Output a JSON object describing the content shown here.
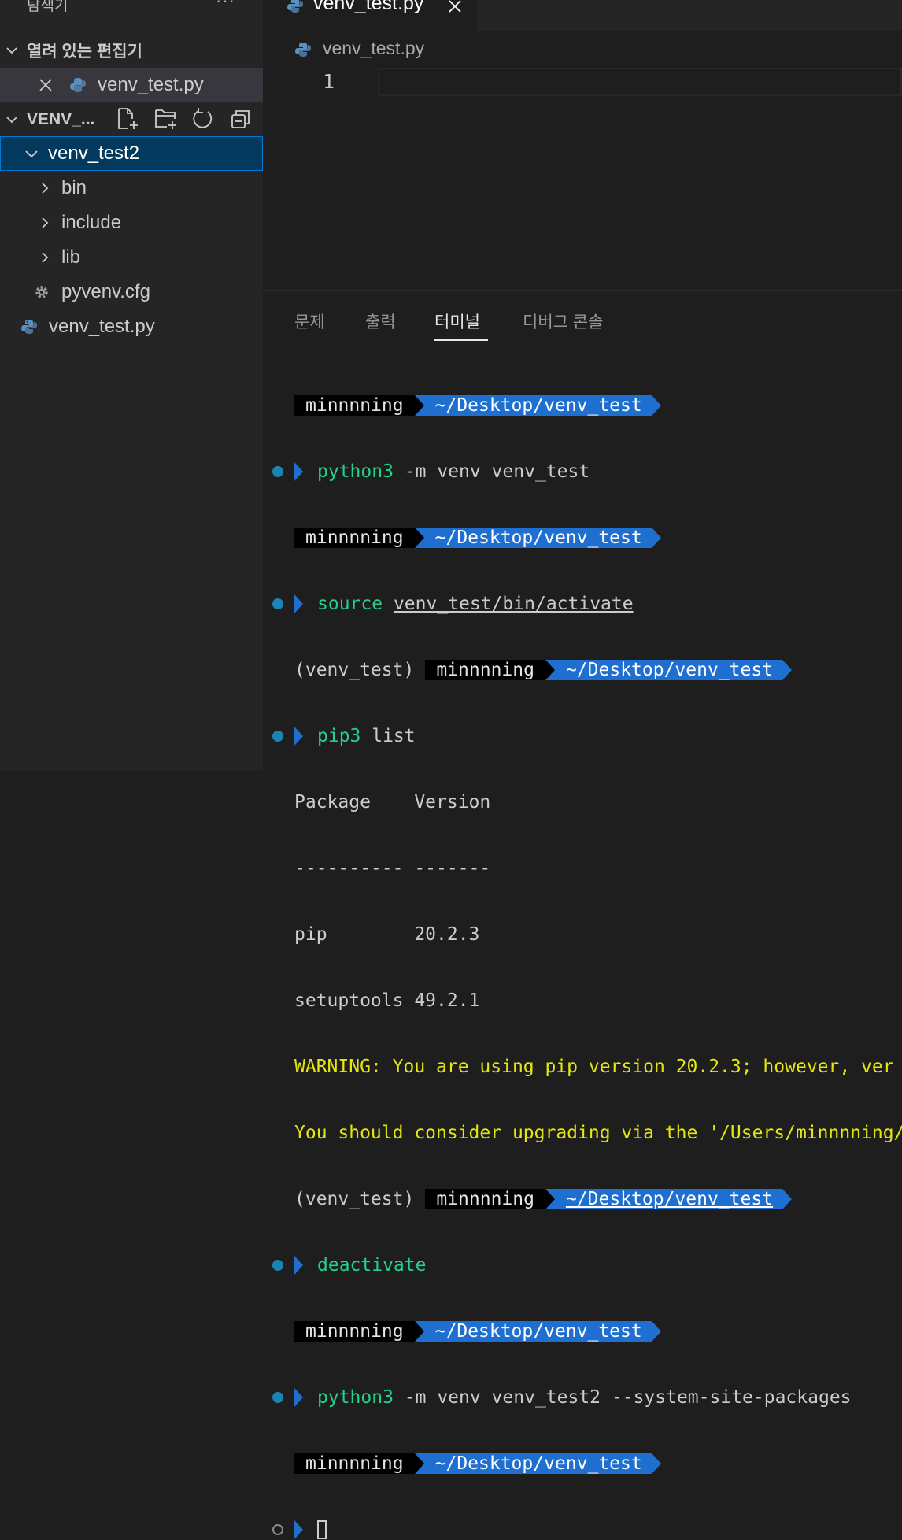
{
  "sidebar": {
    "title": "탐색기",
    "more": "···",
    "open_editors": {
      "title": "열려 있는 편집기",
      "items": [
        {
          "label": "venv_test.py"
        }
      ]
    },
    "folder": {
      "title": "VENV_...",
      "tree": [
        {
          "label": "venv_test2"
        },
        {
          "label": "bin"
        },
        {
          "label": "include"
        },
        {
          "label": "lib"
        },
        {
          "label": "pyvenv.cfg"
        },
        {
          "label": "venv_test.py"
        }
      ]
    }
  },
  "editor": {
    "tab_label": "venv_test.py",
    "breadcrumb": "venv_test.py",
    "line_number": "1"
  },
  "panel": {
    "tabs": [
      "문제",
      "출력",
      "터미널",
      "디버그 콘솔"
    ],
    "active_tab": "터미널"
  },
  "terminal": {
    "user": "minnnning",
    "path": "~/Desktop/venv_test",
    "venv_prefix": "(venv_test)",
    "cmd1": {
      "cmd": "python3",
      "args": " -m venv venv_test"
    },
    "cmd2": {
      "cmd": "source",
      "args": "venv_test/bin/activate"
    },
    "cmd3": {
      "cmd": "pip3",
      "args": " list"
    },
    "out_header": "Package    Version",
    "out_sep": "---------- -------",
    "out_row1": "pip        20.2.3",
    "out_row2": "setuptools 49.2.1",
    "warn1": "WARNING: You are using pip version 20.2.3; however, ver",
    "warn2": "You should consider upgrading via the '/Users/minnnning/",
    "cmd4": {
      "cmd": "deactivate"
    },
    "cmd5": {
      "cmd": "python3",
      "args": " -m venv venv_test2 --system-site-packages"
    }
  },
  "colors": {
    "command": "#23d18b",
    "path_segment": "#1f6fd1",
    "warning": "#e5e510",
    "selection": "#04395e"
  }
}
